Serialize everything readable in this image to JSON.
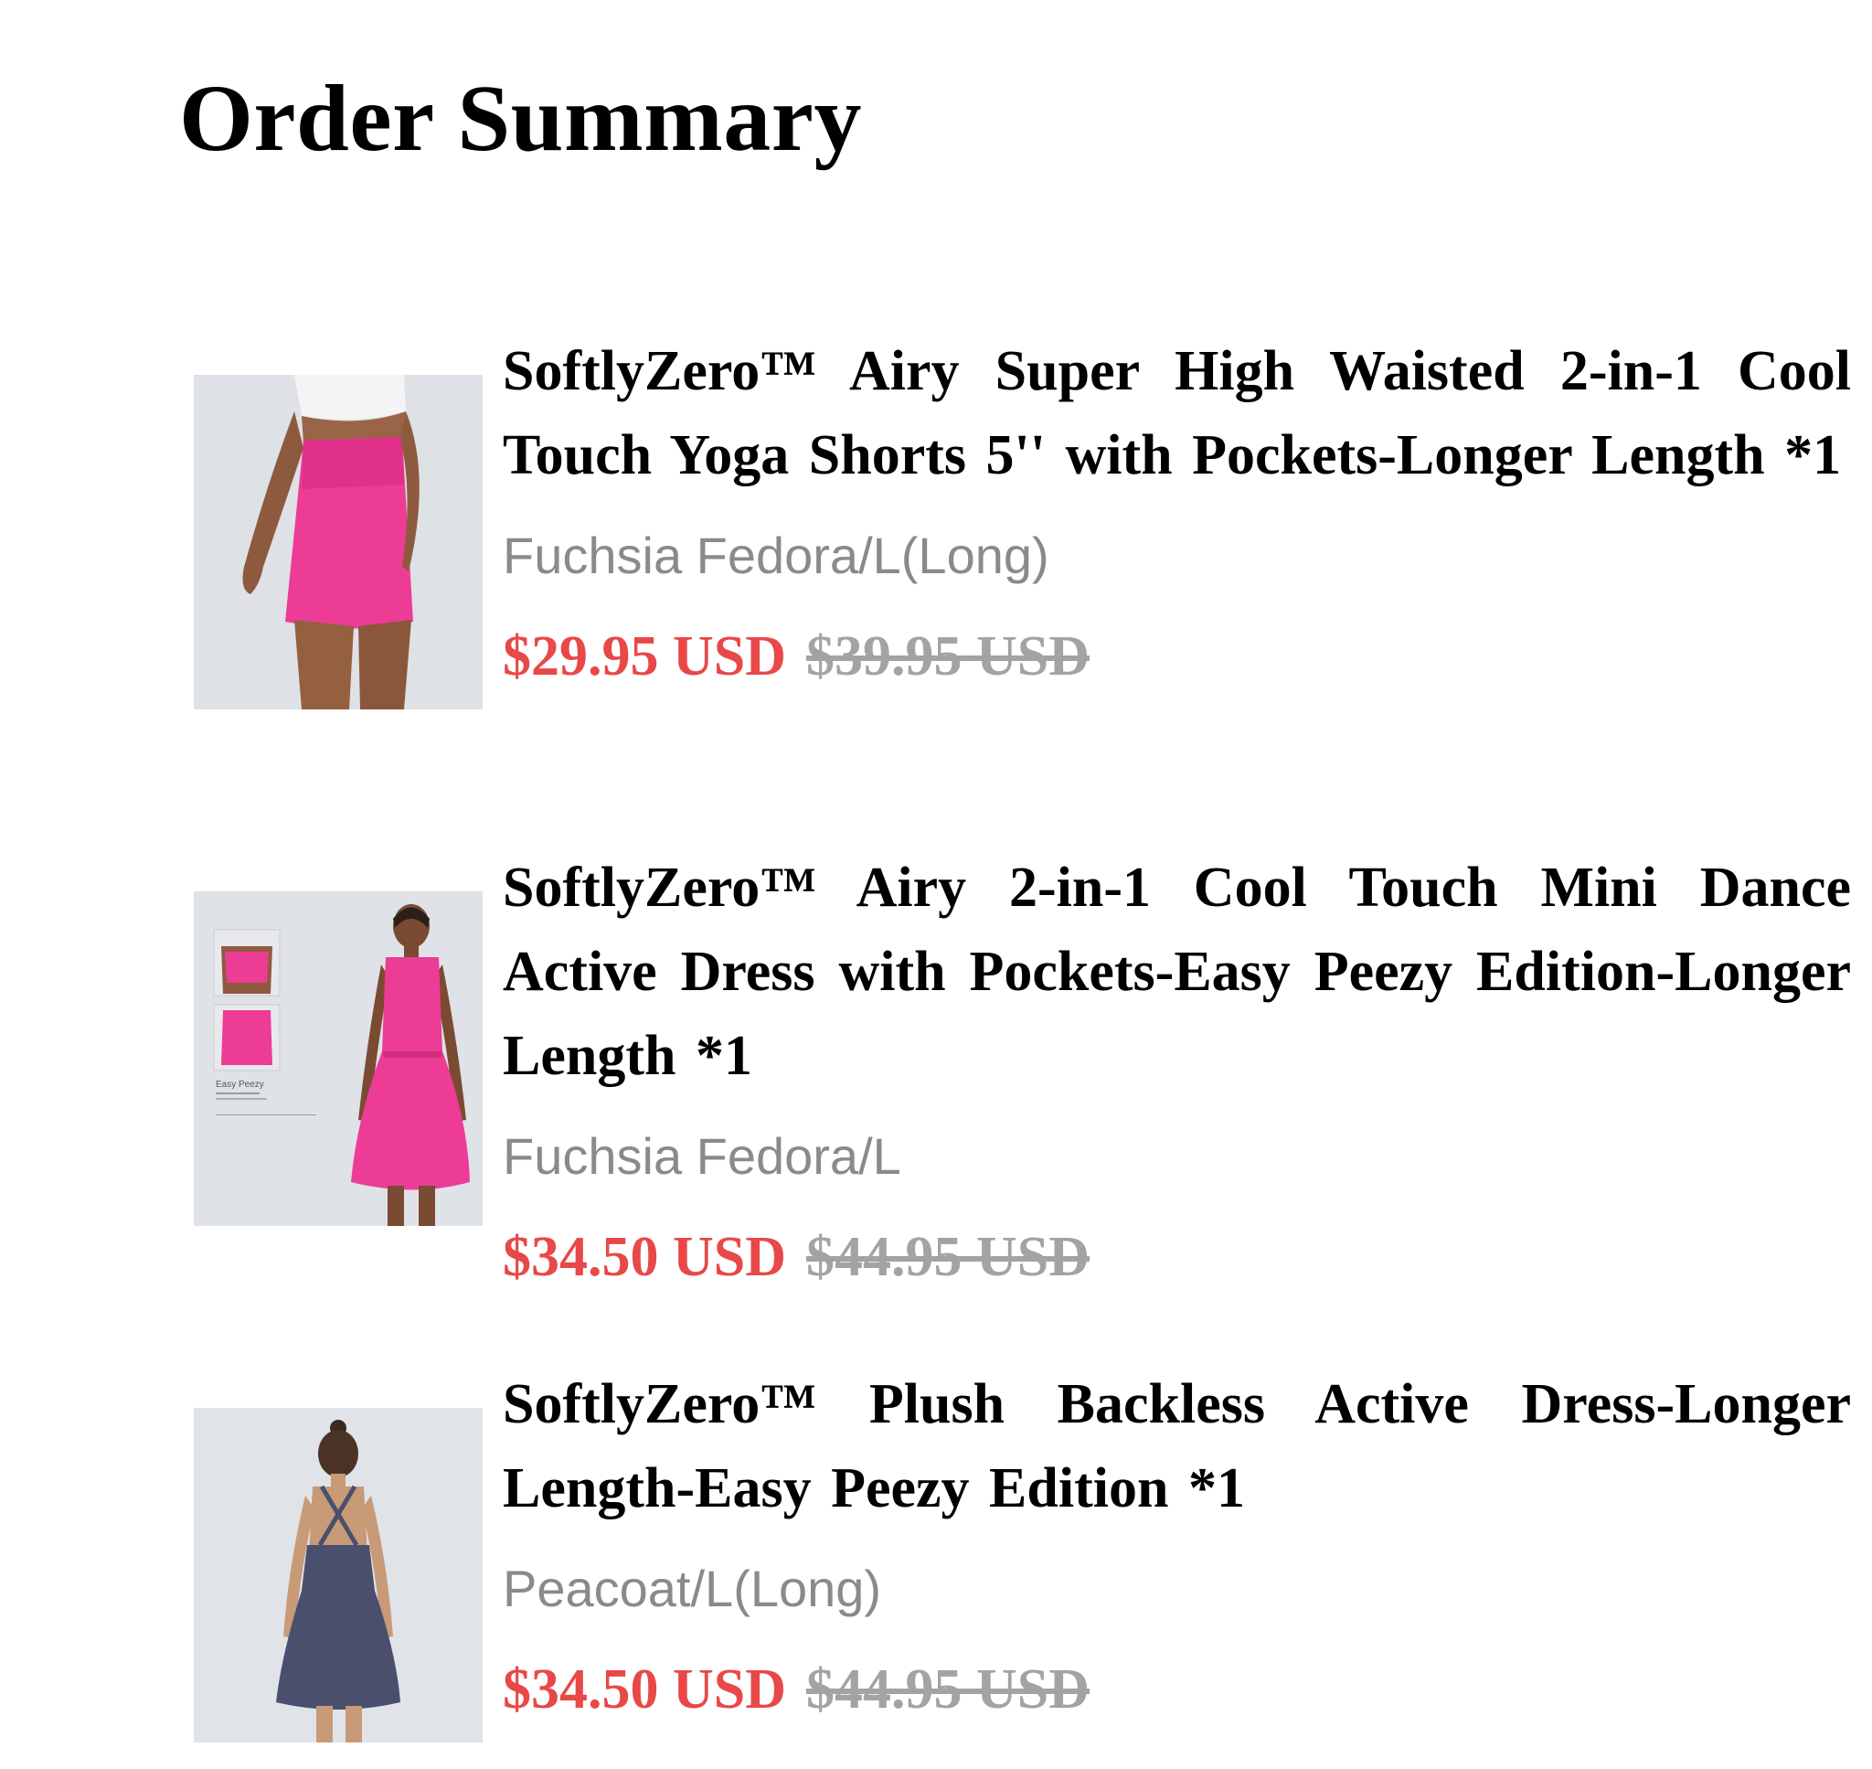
{
  "page": {
    "title": "Order Summary"
  },
  "colors": {
    "sale_price": "#e84848",
    "original_price": "#a3a3a3",
    "variant_text": "#8a8a8a",
    "fuchsia": "#ec3c96",
    "peacoat": "#4a4f6e"
  },
  "items": [
    {
      "title": "SoftlyZero™ Airy Super High Waisted 2-in-1 Cool Touch Yoga Shorts 5'' with Pockets-Longer Length *1",
      "variant": "Fuchsia Fedora/L(Long)",
      "sale_price": "$29.95 USD",
      "original_price": "$39.95 USD",
      "image_icon": "product-photo-shorts"
    },
    {
      "title": "SoftlyZero™ Airy 2-in-1 Cool Touch Mini Dance Active Dress with Pockets-Easy Peezy Edition-Longer Length *1",
      "variant": "Fuchsia Fedora/L",
      "sale_price": "$34.50 USD",
      "original_price": "$44.95 USD",
      "image_icon": "product-photo-dress",
      "image_caption": "Easy Peezy"
    },
    {
      "title": "SoftlyZero™ Plush Backless Active Dress-Longer Length-Easy Peezy Edition *1",
      "variant": "Peacoat/L(Long)",
      "sale_price": "$34.50 USD",
      "original_price": "$44.95 USD",
      "image_icon": "product-photo-backless-dress"
    }
  ]
}
